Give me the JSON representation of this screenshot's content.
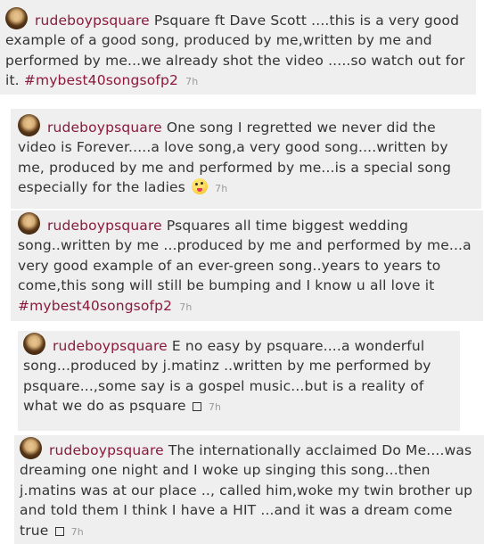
{
  "posts": [
    {
      "username": "rudeboypsquare",
      "text": "Psquare ft Dave Scott ....this is a very good example of a good song, produced by me,written by me and performed by me...we already shot the video .....so watch out for it.",
      "hashtag": "#mybest40songsofp2",
      "time": "7h"
    },
    {
      "username": "rudeboypsquare",
      "text": "One song I regretted we never did the video is Forever.....a love song,a very good song....written by me, produced by me and performed by me...is a special song especially for the ladies",
      "emoji": "winking-face-with-tongue-emoji",
      "time": "7h"
    },
    {
      "username": "rudeboypsquare",
      "text": "Psquares all time biggest wedding song..written by me ...produced by me and performed by me...a very good example of an ever-green song..years to years to come,this song will still be bumping and I know u all love it",
      "hashtag": "#mybest40songsofp2",
      "time": "7h"
    },
    {
      "username": "rudeboypsquare",
      "text": "E no easy by psquare....a wonderful song...produced by j.matinz ..written by me performed by psquare...,some say is a gospel music...but is a reality of what we do as psquare",
      "time": "7h"
    },
    {
      "username": "rudeboypsquare",
      "text": "The internationally acclaimed Do Me....was dreaming one night and I woke up singing this song...then j.matins was at our place .., called him,woke my twin brother up and told them I think I have a HIT ...and it was a dream come true",
      "time": "7h"
    }
  ],
  "colors": {
    "card_background": "#efefef",
    "username": "#8a1a3c",
    "hashtag": "#8a1a3c",
    "body_text": "#333333",
    "timestamp": "#9a9a9a"
  }
}
